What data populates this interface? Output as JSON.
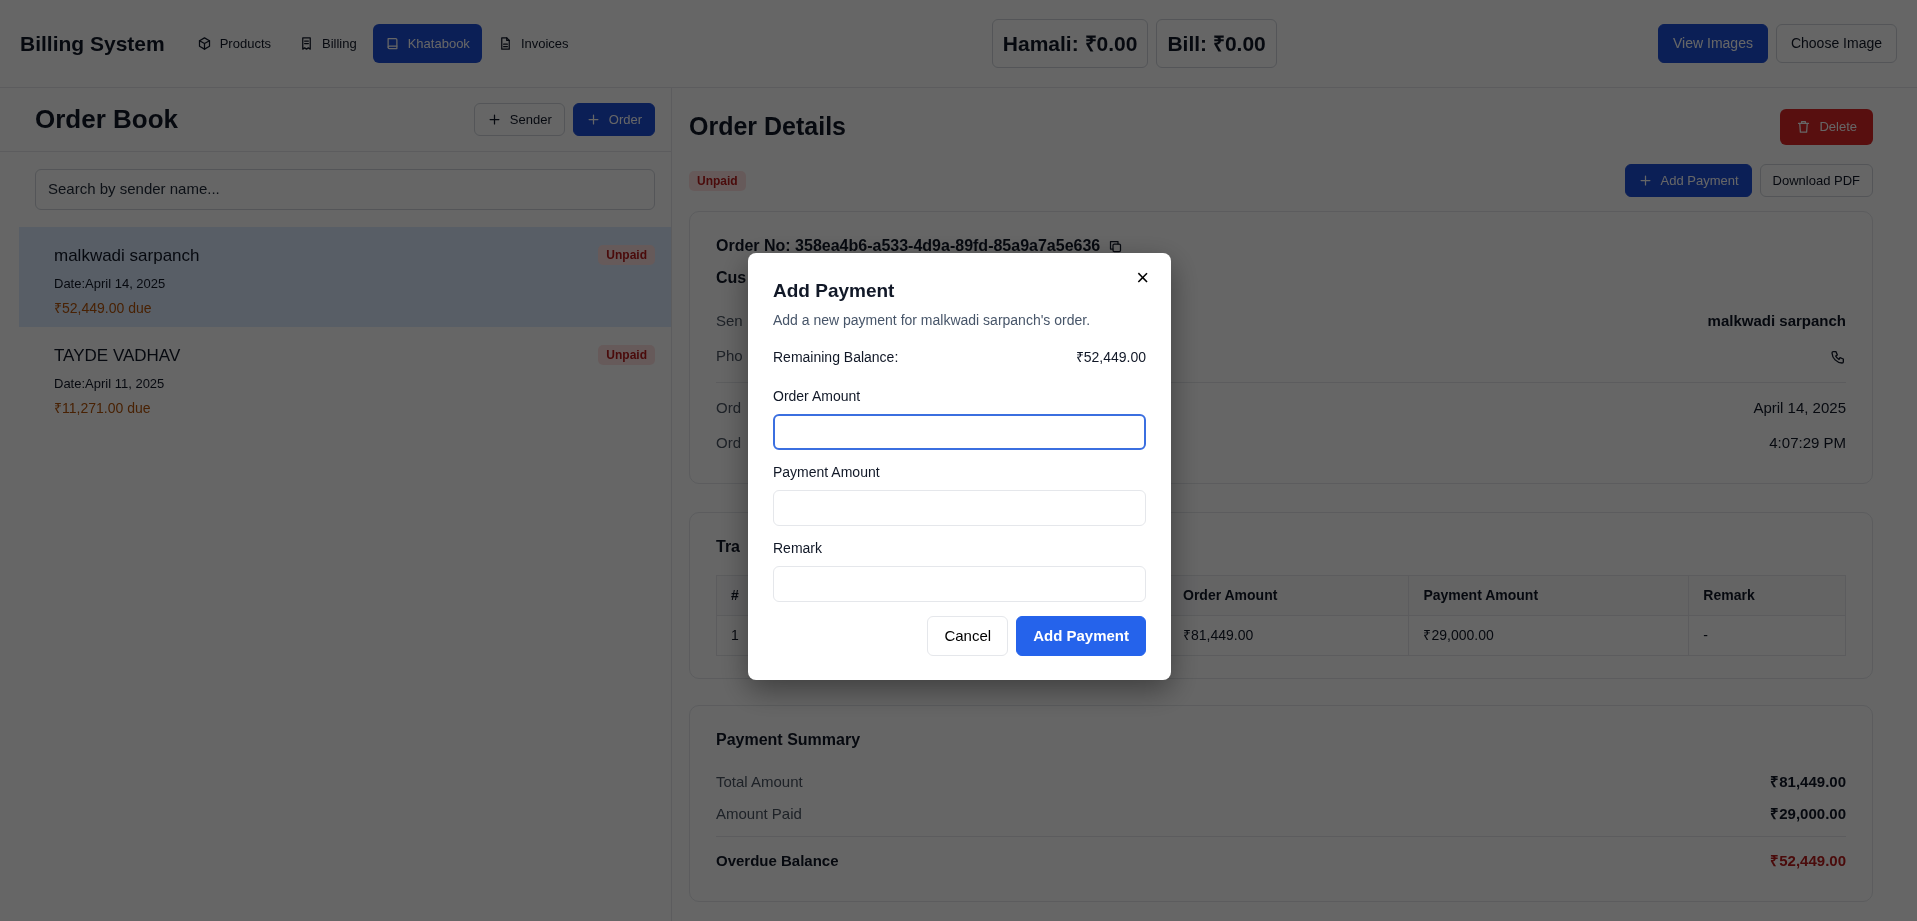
{
  "app": {
    "title": "Billing System"
  },
  "nav": [
    {
      "label": "Products",
      "selected": false
    },
    {
      "label": "Billing",
      "selected": false
    },
    {
      "label": "Khatabook",
      "selected": true
    },
    {
      "label": "Invoices",
      "selected": false
    }
  ],
  "totals": [
    {
      "label": "Hamali: ₹0.00"
    },
    {
      "label": "Bill: ₹0.00"
    }
  ],
  "header_buttons": [
    {
      "label": "View Images",
      "kind": "primary"
    },
    {
      "label": "Choose Image",
      "kind": "outline"
    }
  ],
  "order_book": {
    "title": "Order Book",
    "buttons": [
      {
        "label": "Sender",
        "kind": "outline"
      },
      {
        "label": "Order",
        "kind": "primary"
      }
    ],
    "search": {
      "placeholder": "Search by sender name..."
    },
    "orders": [
      {
        "name": "malkwadi sarpanch",
        "date": "Date:April 14, 2025",
        "due": "₹52,449.00 due",
        "status": "Unpaid",
        "selected": true
      },
      {
        "name": "TAYDE VADHAV",
        "date": "Date:April 11, 2025",
        "due": "₹11,271.00 due",
        "status": "Unpaid",
        "selected": false
      }
    ]
  },
  "details": {
    "title": "Order Details",
    "delete": "Delete",
    "status": "Unpaid",
    "actions": [
      {
        "label": "Add Payment",
        "kind": "primary"
      },
      {
        "label": "Download PDF",
        "kind": "outline"
      }
    ],
    "order_no": "Order No: 358ea4b6-a533-4d9a-89fd-85a9a7a5e636",
    "customer_label": "Cus",
    "rows": [
      {
        "label": "Sen",
        "value": "malkwadi sarpanch",
        "kind": "text"
      },
      {
        "label": "Pho",
        "kind": "phone"
      }
    ],
    "rows2": [
      {
        "label": "Ord",
        "value": "April 14, 2025"
      },
      {
        "label": "Ord",
        "value": "4:07:29 PM"
      }
    ],
    "transactions": {
      "title": "Tra",
      "columns": [
        "#",
        "Order Amount",
        "Payment Amount",
        "Remark"
      ],
      "rows": [
        [
          "1",
          "₹81,449.00",
          "₹29,000.00",
          "-"
        ]
      ]
    },
    "summary": {
      "title": "Payment Summary",
      "rows": [
        {
          "label": "Total Amount",
          "value": "₹81,449.00"
        },
        {
          "label": "Amount Paid",
          "value": "₹29,000.00"
        }
      ],
      "total": {
        "label": "Overdue Balance",
        "value": "₹52,449.00"
      }
    }
  },
  "modal": {
    "title": "Add Payment",
    "subtitle": "Add a new payment for malkwadi sarpanch's order.",
    "close": "×",
    "balance_label": "Remaining Balance:",
    "balance_value": "₹52,449.00",
    "fields": [
      {
        "label": "Order Amount",
        "focused": true
      },
      {
        "label": "Payment Amount",
        "focused": false
      },
      {
        "label": "Remark",
        "focused": false
      }
    ],
    "buttons": [
      {
        "label": "Cancel",
        "kind": "outline"
      },
      {
        "label": "Add Payment",
        "kind": "primary"
      }
    ]
  }
}
